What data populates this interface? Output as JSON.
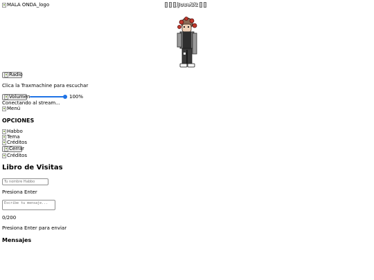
{
  "logo": {
    "alt": "MALA ONDA_logo"
  },
  "user": {
    "name": "Jose22"
  },
  "player": {
    "radio_alt": "Radio",
    "hint": "Clica la Traxmachine para escuchar",
    "volume_alt": "Volumen",
    "volume_percent": 100,
    "volume_text": "100%",
    "status": "Conectando al stream...",
    "menu_alt": "Menú"
  },
  "options": {
    "title": "OPCIONES",
    "items": [
      "Habbo",
      "Tema",
      "Créditos"
    ],
    "close_alt": "Cerrar",
    "credits_alt": "Créditos"
  },
  "guestbook": {
    "title": "Libro de Visitas",
    "name_placeholder": "Tu nombre Habbo",
    "name_hint": "Presiona Enter",
    "message_placeholder": "Escribe tu mensaje...",
    "counter": "0/200",
    "send_hint": "Presiona Enter para enviar",
    "messages_title": "Mensajes"
  },
  "colors": {
    "accent": "#1f73e6"
  }
}
